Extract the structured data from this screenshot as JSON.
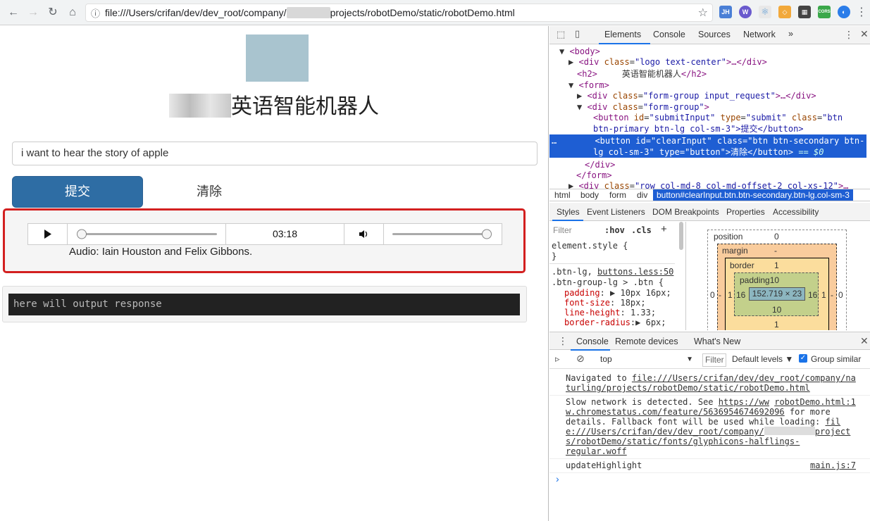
{
  "browser": {
    "url_prefix": "file:///Users/crifan/dev/dev_root/company/",
    "url_suffix": "projects/robotDemo/static/robotDemo.html",
    "extensions": [
      "JH",
      "W",
      "⚛",
      "◇",
      "▦",
      "CORS",
      "◐"
    ]
  },
  "page": {
    "title": "英语智能机器人",
    "input_value": "i want to hear the story of apple",
    "submit_label": "提交",
    "clear_label": "清除",
    "audio_time": "03:18",
    "audio_progress": 0.0,
    "audio_volume": 1.0,
    "audio_credit": "Audio: Iain Houston and Felix Gibbons.",
    "response_placeholder": "here will output response"
  },
  "devtools": {
    "tabs": [
      "Elements",
      "Console",
      "Sources",
      "Network",
      "»"
    ],
    "active_tab": "Elements",
    "dom": {
      "l1": "<body>",
      "l2_tag": "div",
      "l2_attr": "class",
      "l2_val": "\"logo text-center\"",
      "l2_rest": ">…</div>",
      "l3_open": "<h2>",
      "l3_text": "英语智能机器人",
      "l3_close": "</h2>",
      "l4": "<form>",
      "l5_val": "\"form-group input_request\"",
      "l5_rest": ">…</div>",
      "l6_val": "\"form-group\"",
      "l7_a": "<button ",
      "l7_id": "\"submitInput\"",
      "l7_type": "\"submit\"",
      "l7_class": "\"btn",
      "l8": "btn-primary btn-lg col-sm-3\">提交</button>",
      "l9_a": "<button id=\"clearInput\" class=\"btn btn-secondary btn-",
      "l10": "lg col-sm-3\" type=\"button\">清除</button>",
      "l10_eq": "== $0",
      "l11": "</div>",
      "l12": "</form>",
      "l13_val": "\"row col-md-8 col-md-offset-2 col-xs-12\"",
      "l13_rest": ">…"
    },
    "breadcrumb": [
      "html",
      "body",
      "form",
      "div",
      "button#clearInput.btn.btn-secondary.btn-lg.col-sm-3"
    ],
    "subtabs": [
      "Styles",
      "Event Listeners",
      "DOM Breakpoints",
      "Properties",
      "Accessibility"
    ],
    "filter_placeholder": "Filter",
    "hov": ":hov",
    "cls": ".cls",
    "styles": {
      "element_style": "element.style {",
      "close_brace": "}",
      "sel1": ".btn-lg,",
      "src1": "buttons.less:50",
      "sel2": ".btn-group-lg > .btn {",
      "props": [
        {
          "name": "padding",
          "value": "10px 16px;",
          "arrow": true
        },
        {
          "name": "font-size",
          "value": "18px;",
          "arrow": false
        },
        {
          "name": "line-height",
          "value": "1.33;",
          "arrow": false
        },
        {
          "name": "border-radius",
          "value": "6px;",
          "arrow": true
        }
      ]
    },
    "boxmodel": {
      "position_label": "position",
      "position_val": "0",
      "margin_label": "margin",
      "margin_val": "-",
      "border_label": "border",
      "border_val": "1",
      "padding_label": "padding",
      "padding_top": "10",
      "content": "152.719 × 23",
      "left_margin": "-",
      "left_border": "1",
      "left_padding": "16",
      "right_padding": "16",
      "right_border": "1",
      "right_margin": "-",
      "left_pos": "0",
      "right_pos": "0",
      "bottom_padding": "10",
      "bottom_border": "1"
    },
    "drawer_tabs": [
      "Console",
      "Remote devices",
      "What's New"
    ],
    "console_context": "top",
    "console_filter": "Filter",
    "levels": "Default levels",
    "group_similar": "Group similar",
    "messages": {
      "m1a": "Navigated to ",
      "m1link": "file:///Users/crifan/dev/dev_root/company/na",
      "m1b": "turling/projects/robotDemo/static/robotDemo.html",
      "m2a": "Slow network is detected. See ",
      "m2link": "https://ww",
      "m2src": "robotDemo.html:1",
      "m2b": "w.chromestatus.com/feature/5636954674692096",
      "m2c": " for more",
      "m2d": "details. Fallback font will be used while loading: ",
      "m2e": "fil",
      "m2f": "e:///Users/crifan/dev/dev_root/company/",
      "m2g": "project",
      "m2h": "s/robotDemo/static/fonts/glyphicons-halflings-",
      "m2i": "regular.woff",
      "m3": "updateHighlight",
      "m3src": "main.js:7",
      "prompt": "›"
    }
  }
}
